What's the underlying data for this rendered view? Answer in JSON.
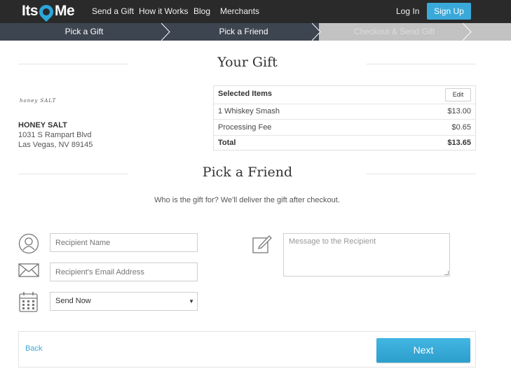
{
  "brand": {
    "logo_left": "Its",
    "logo_right": "Me"
  },
  "nav": {
    "links": [
      "Send a Gift",
      "How it Works",
      "Blog",
      "Merchants"
    ],
    "login": "Log In",
    "signup": "Sign Up"
  },
  "steps": [
    "Pick a Gift",
    "Pick a Friend",
    "Checkout & Send Gift"
  ],
  "gift_section": {
    "title": "Your Gift"
  },
  "merchant": {
    "logo_text": "honey SALT",
    "name": "HONEY SALT",
    "address_line1": "1031 S Rampart Blvd",
    "address_line2": "Las Vegas, NV 89145"
  },
  "items": {
    "header": "Selected Items",
    "edit_label": "Edit",
    "rows": [
      {
        "label": "1   Whiskey Smash",
        "value": "$13.00"
      },
      {
        "label": "Processing Fee",
        "value": "$0.65"
      }
    ],
    "total_label": "Total",
    "total_value": "$13.65"
  },
  "friend_section": {
    "title": "Pick a Friend",
    "subtitle": "Who is the gift for? We'll deliver the gift after checkout."
  },
  "form": {
    "recipient_name_placeholder": "Recipient Name",
    "recipient_email_placeholder": "Recipient's Email Address",
    "send_option": "Send Now",
    "message_placeholder": "Message to the Recipient"
  },
  "footer": {
    "back_label": "Back",
    "next_label": "Next"
  },
  "colors": {
    "accent": "#3aa9d9",
    "nav_bg": "#2a2a2a",
    "step_active": "#3d4550",
    "step_inactive": "#c2c2c2"
  }
}
